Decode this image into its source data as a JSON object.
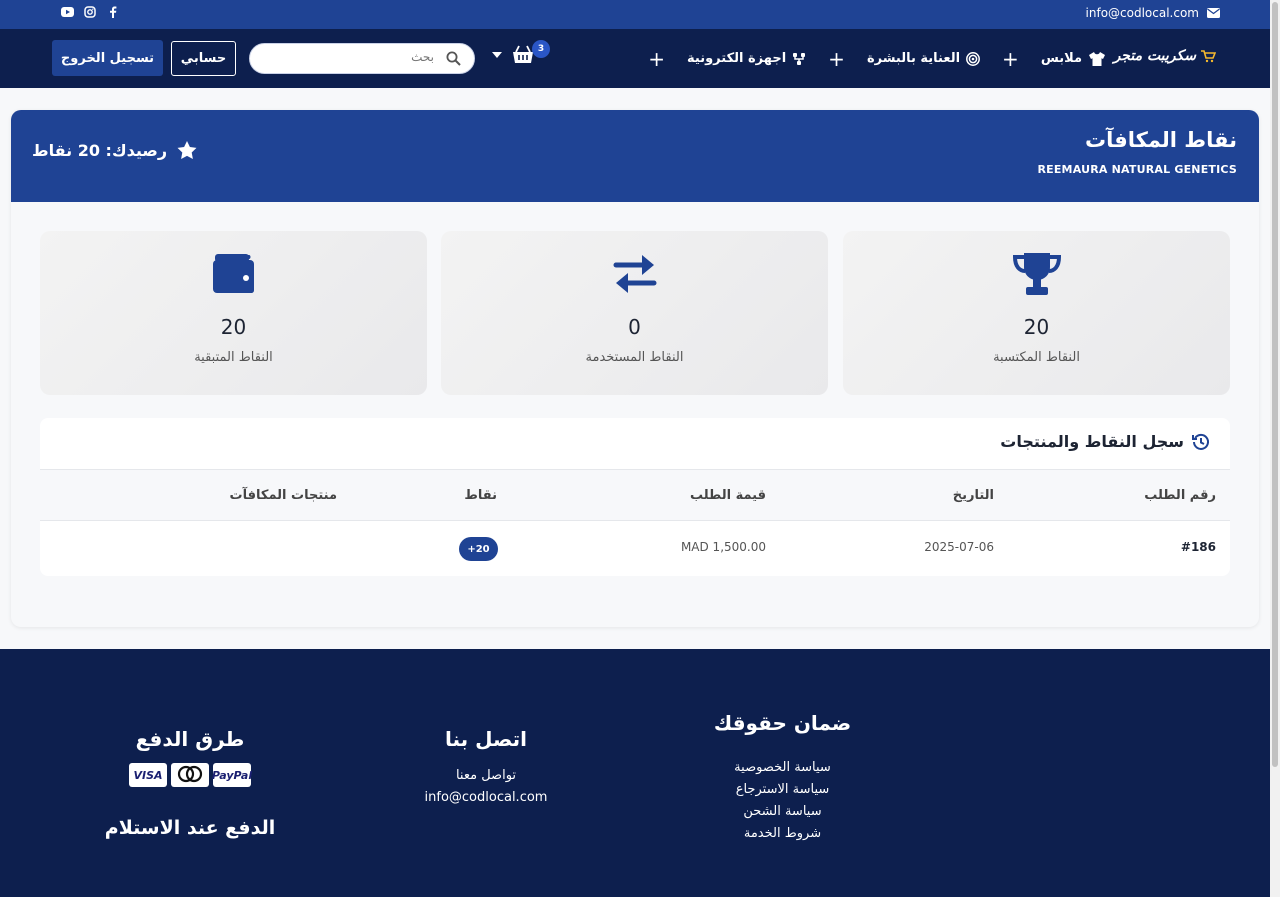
{
  "topbar": {
    "email": "info@codlocal.com",
    "social": [
      "youtube-icon",
      "instagram-icon",
      "facebook-icon"
    ]
  },
  "nav": {
    "logo": "سكريبت متجر",
    "menu": [
      {
        "label": "ملابس",
        "icon": "shirt-icon"
      },
      {
        "label": "العناية بالبشرة",
        "icon": "target-icon"
      },
      {
        "label": "اجهزة الكترونية",
        "icon": "chip-icon"
      }
    ],
    "plus": "+",
    "cart_count": "3",
    "search_placeholder": "بحث",
    "account_label": "حسابي",
    "logout_label": "تسجيل الخروج"
  },
  "rewards": {
    "title": "نقاط المكافآت",
    "subtitle": "REEMAURA NATURAL GENETICS",
    "balance": "رصيدك: 20 نقاط",
    "stats": [
      {
        "value": "20",
        "label": "النقاط المكتسبة",
        "icon": "trophy-icon"
      },
      {
        "value": "0",
        "label": "النقاط المستخدمة",
        "icon": "exchange-icon"
      },
      {
        "value": "20",
        "label": "النقاط المتبقية",
        "icon": "wallet-icon"
      }
    ]
  },
  "history": {
    "title": "سجل النقاط والمنتجات",
    "columns": [
      "رقم الطلب",
      "التاريخ",
      "قيمة الطلب",
      "نقاط",
      "منتجات المكافآت"
    ],
    "rows": [
      {
        "order": "#186",
        "date": "2025-07-06",
        "amount": "MAD 1,500.00",
        "points": "+20",
        "products": ""
      }
    ]
  },
  "footer": {
    "rights": {
      "title": "ضمان حقوقك",
      "links": [
        "سياسة الخصوصية",
        "سياسة الاسترجاع",
        "سياسة الشحن",
        "شروط الخدمة"
      ]
    },
    "contact": {
      "title": "اتصل بنا",
      "links": [
        "تواصل معنا",
        "info@codlocal.com"
      ]
    },
    "payment": {
      "title": "طرق الدفع",
      "cards": [
        "VISA",
        "mastercard",
        "PayPal"
      ],
      "cod": "الدفع عند الاستلام"
    }
  },
  "colors": {
    "primary": "#1f4394",
    "navy": "#0d1f4e"
  }
}
